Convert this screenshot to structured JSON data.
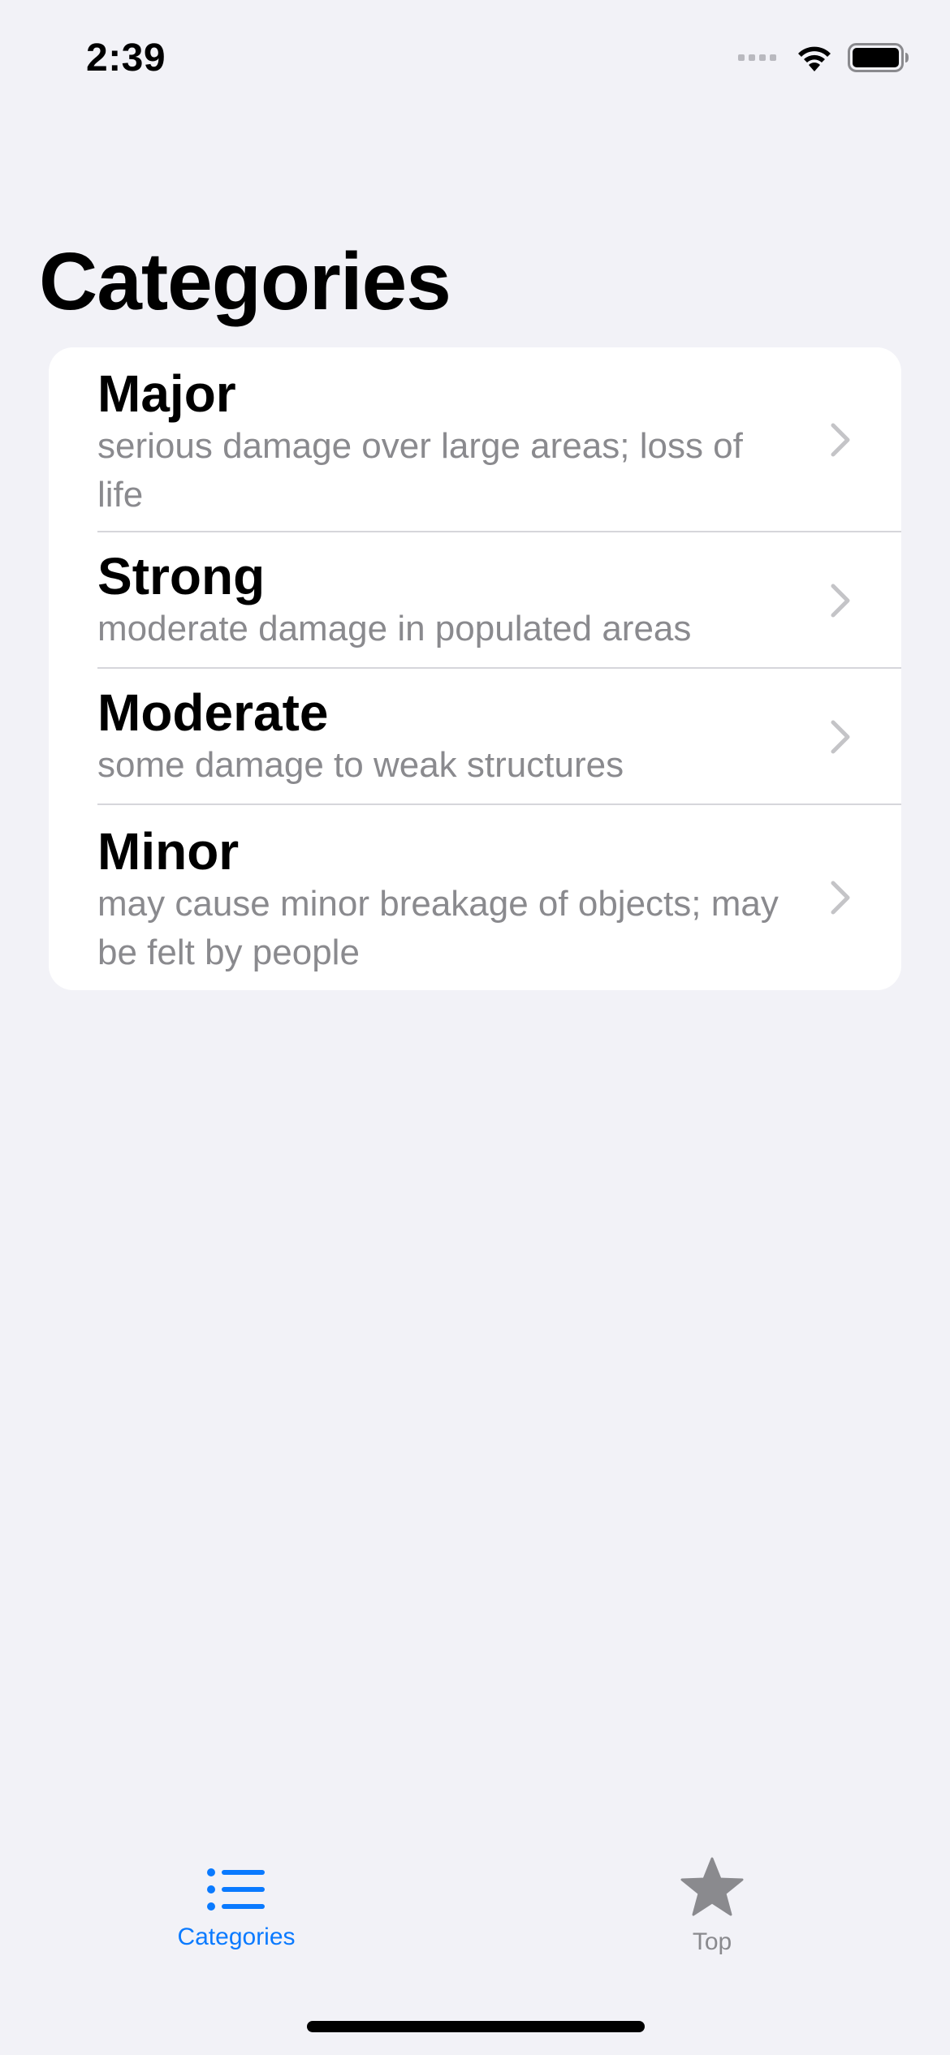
{
  "status_bar": {
    "time": "2:39",
    "icons": [
      "cellular-signal-icon",
      "wifi-icon",
      "battery-icon"
    ]
  },
  "page": {
    "title": "Categories"
  },
  "categories": [
    {
      "title": "Major",
      "subtitle": "serious damage over large areas; loss of life"
    },
    {
      "title": "Strong",
      "subtitle": "moderate damage in populated areas"
    },
    {
      "title": "Moderate",
      "subtitle": "some damage to weak structures"
    },
    {
      "title": "Minor",
      "subtitle": "may cause minor breakage of objects; may be felt by people"
    }
  ],
  "tab_bar": {
    "tabs": [
      {
        "label": "Categories",
        "icon": "list-bullet-icon",
        "active": true
      },
      {
        "label": "Top",
        "icon": "star-icon",
        "active": false
      }
    ]
  },
  "colors": {
    "accent": "#0a7aff",
    "background": "#f2f2f7",
    "secondary_text": "#8a8a8e",
    "card": "#ffffff"
  }
}
